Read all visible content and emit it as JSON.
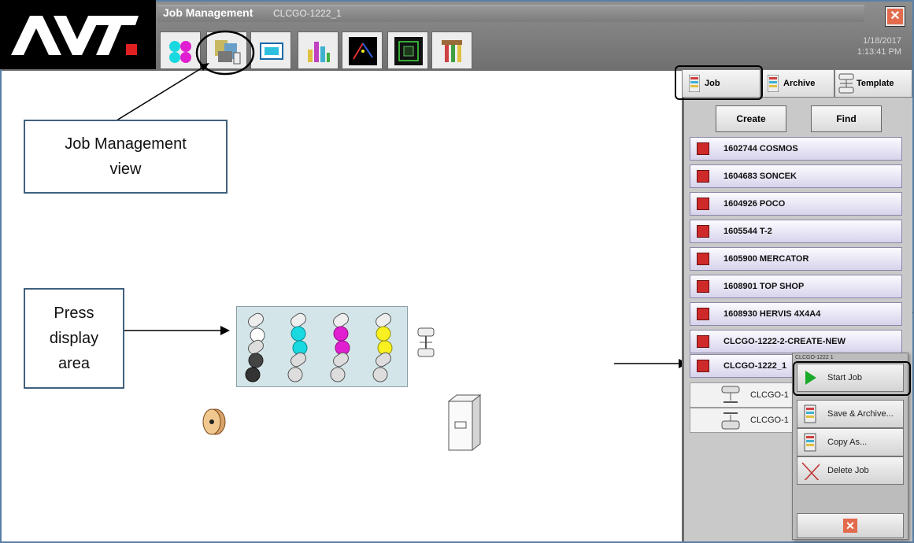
{
  "app": {
    "logo_text": "AVT",
    "title": "Job Management",
    "current_job": "CLCGO-1222_1",
    "date": "1/18/2017",
    "time": "1:13:41 PM",
    "close_glyph": "✕"
  },
  "toolbar": {
    "buttons": [
      {
        "name": "ink-icon"
      },
      {
        "name": "job-management-icon"
      },
      {
        "name": "monitor-icon"
      },
      {
        "name": "bar-chart-icon"
      },
      {
        "name": "graph-icon"
      },
      {
        "name": "inspection-icon"
      },
      {
        "name": "tools-icon"
      }
    ]
  },
  "callouts": {
    "job_management_line1": "Job Management",
    "job_management_line2": "view",
    "press_line1": "Press",
    "press_line2": "display",
    "press_line3": "area"
  },
  "tabs": {
    "job": "Job",
    "archive": "Archive",
    "template": "Template"
  },
  "actions": {
    "create": "Create",
    "find": "Find"
  },
  "jobs": [
    "1602744 COSMOS",
    "1604683 SONCEK",
    "1604926 POCO",
    "1605544 T-2",
    "1605900 MERCATOR",
    "1608901 TOP SHOP",
    "1608930 HERVIS 4X4A4",
    "CLCGO-1222-2-CREATE-NEW",
    "CLCGO-1222_1"
  ],
  "sub_rows": [
    "CLCGO-1",
    "CLCGO-1"
  ],
  "context_menu": {
    "title": "CLCGO-1222 1",
    "start_job": "Start Job",
    "save_archive": "Save & Archive...",
    "copy_as": "Copy As...",
    "delete_job": "Delete Job",
    "close_glyph": "✕"
  },
  "colors": {
    "cyan": "#18d8e0",
    "magenta": "#e020d0",
    "yellow": "#f8f020",
    "job_square": "#cf2a2a",
    "press_bg": "#d3e5e8"
  }
}
